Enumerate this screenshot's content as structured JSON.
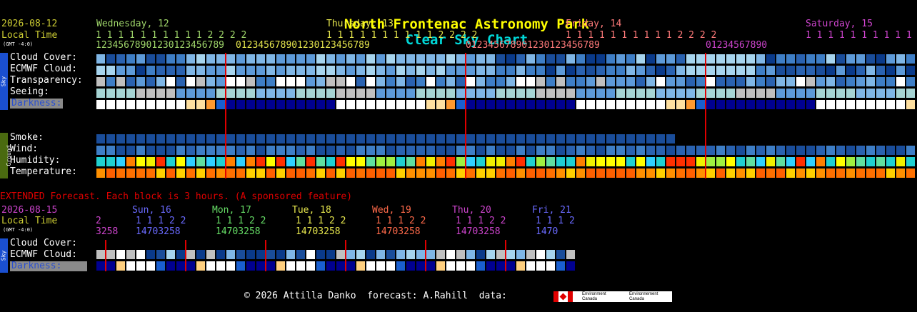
{
  "title": {
    "name": "North Frontenac Astronomy Park",
    "suffix": "Clear Sky Chart"
  },
  "colors": {
    "title_name": "#ffff00",
    "title_suffix": "#00d7d7",
    "marker": "#e00000"
  },
  "main": {
    "date": "2026-08-12",
    "local_time": "Local Time",
    "gmt": "(GMT -4:0)",
    "days": [
      {
        "label": "Wednesday, 12",
        "color": "#9fd66a"
      },
      {
        "label": "Thursday, 13",
        "color": "#e6e64d"
      },
      {
        "label": "Friday, 14",
        "color": "#ff7a7a"
      },
      {
        "label": "Saturday, 15",
        "color": "#cc44cc"
      }
    ],
    "hours": [
      {
        "tens": "1 1 1 1 1 1 1 1 1 1 2 2 2 2",
        "ones": "1 2 3 4 5 6 7 8 9 0 1 2 3 0 1 2 3 4 5 6 7 8 9",
        "color": "#9fd66a"
      },
      {
        "tens": "1 1 1 1 1 1 1 1 1 1 2 2 2 2",
        "ones": "0 1 2 3 4 5 6 7 8 9 0 1 2 3 0 1 2 3 4 5 6 7 8 9",
        "color": "#e6e64d"
      },
      {
        "tens": "1 1 1 1 1 1 1 1 1 1 2 2 2 2",
        "ones": "0 1 2 3 4 5 6 7 8 9 0 1 2 3 0 1 2 3 4 5 6 7 8 9",
        "color": "#ff7a7a"
      },
      {
        "tens": "1 1 1 1 1 1 1 1 1 1 1 2",
        "ones": "0 1 2 3 4 5 6 7 8 9 0",
        "color": "#cc44cc"
      }
    ],
    "sky_rows": [
      "Cloud Cover:",
      "ECMWF Cloud:",
      "Transparency:",
      "Seeing:",
      "Darkness:"
    ],
    "ground_rows": [
      "Smoke:",
      "Wind:",
      "Humidity:",
      "Temperature:"
    ],
    "sky_tab": "Sky",
    "ground_tab": "Ground"
  },
  "extended": {
    "notice": "EXTENDED Forecast. Each block is 3 hours. (A sponsored feature)",
    "date": "2026-08-15",
    "local_time": "Local Time",
    "gmt": "(GMT -4:0)",
    "days": [
      {
        "label": "Sun, 16",
        "color": "#6a6aff"
      },
      {
        "label": "Mon, 17",
        "color": "#66dd66"
      },
      {
        "label": "Tue, 18",
        "color": "#e6e64d"
      },
      {
        "label": "Wed, 19",
        "color": "#ff6a4a"
      },
      {
        "label": "Thu, 20",
        "color": "#cc44cc"
      },
      {
        "label": "Fri, 21",
        "color": "#6a6aff"
      }
    ],
    "tens": [
      "2",
      "1 1 1 2 2",
      "1 1 1 2 2",
      "1 1 1 2 2",
      "1 1 1 2 2",
      "1 1 1 2 2",
      "1 1 1 2"
    ],
    "ones": [
      "3 2 5 8",
      "1 4 7 0 3 2 5 8",
      "1 4 7 0 3 2 5 8",
      "1 4 7 0 3 2 5 8",
      "1 4 7 0 3 2 5 8",
      "1 4 7 0 3 2 5 8",
      "1 4 7 0"
    ],
    "rows": [
      "Cloud Cover:",
      "ECMWF Cloud:",
      "Darkness:"
    ],
    "sky_tab": "Sky"
  },
  "footer": {
    "text": "© 2026 Attilla Danko  forecast: A.Rahill  data:",
    "logo_text_1": "Environment Canada",
    "logo_text_2": "Environnement Canada"
  }
}
